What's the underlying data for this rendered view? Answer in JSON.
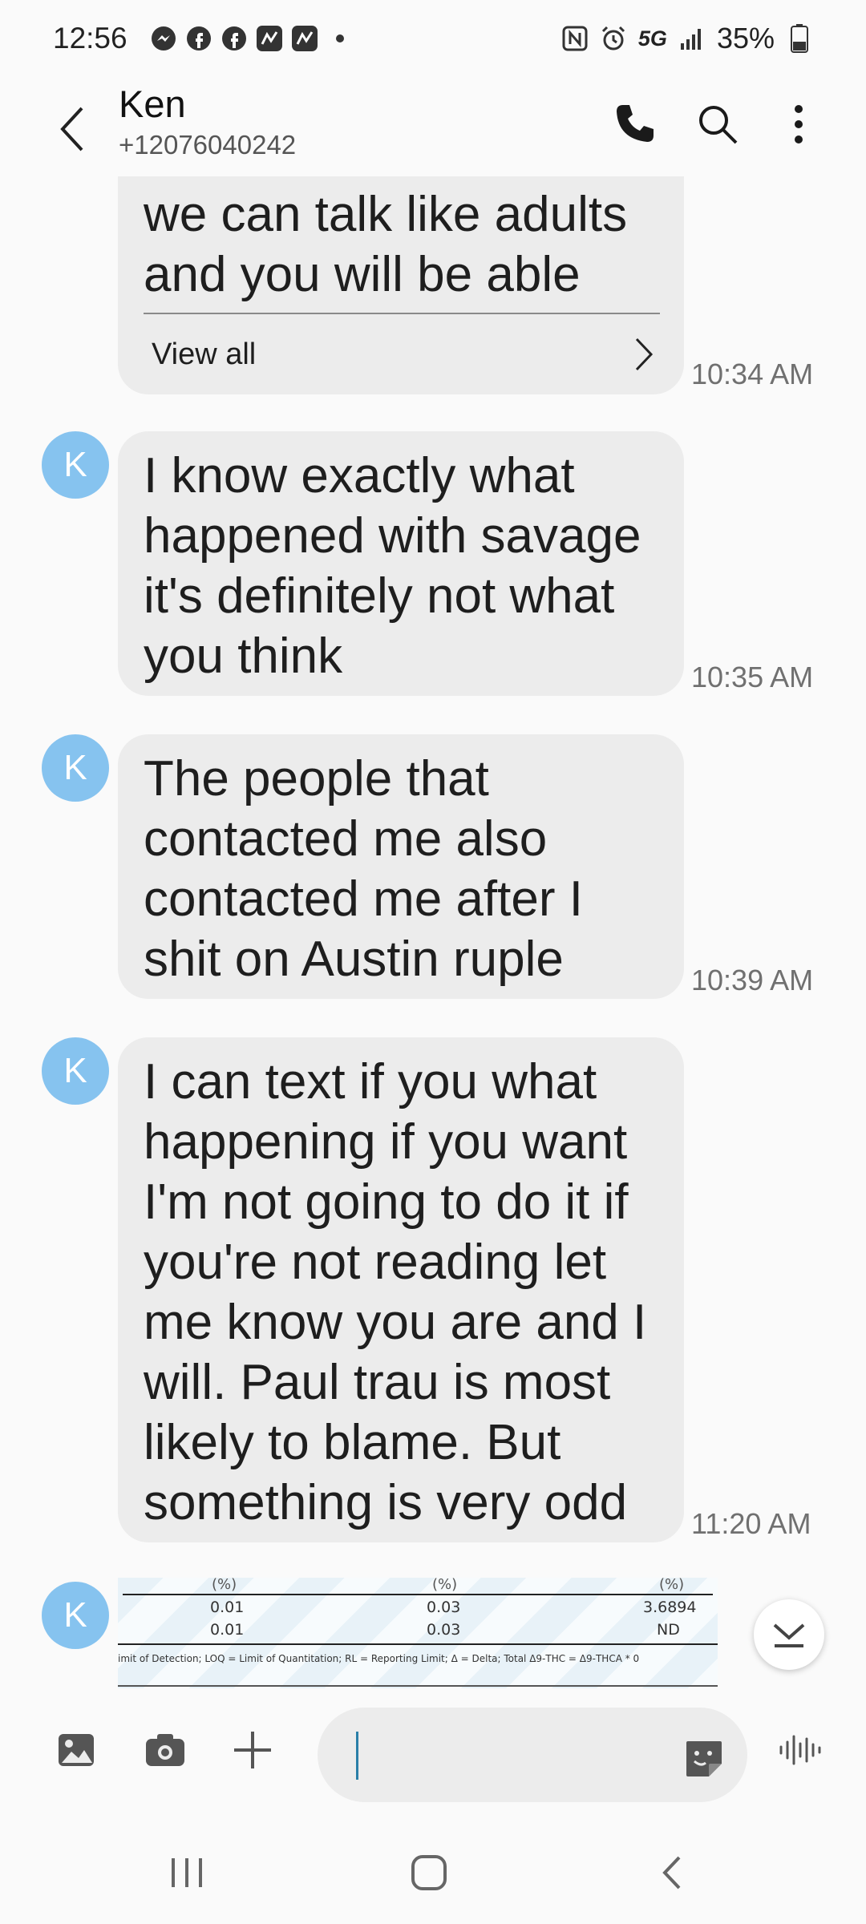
{
  "status_bar": {
    "time": "12:56",
    "network": "5G",
    "battery": "35%"
  },
  "header": {
    "contact_name": "Ken",
    "contact_number": "+12076040242"
  },
  "messages": [
    {
      "text": "we can talk like adults\nand you will be able",
      "timestamp": "10:34 AM",
      "view_all_label": "View all"
    },
    {
      "avatar": "K",
      "text": "I know exactly what\nhappened with savage\nit's definitely not what\nyou think",
      "timestamp": "10:35 AM"
    },
    {
      "avatar": "K",
      "text": "The people that\ncontacted me also\ncontacted me after I\nshit on Austin ruple",
      "timestamp": "10:39 AM"
    },
    {
      "avatar": "K",
      "text": "I can text if you what\nhappening if you want\nI'm not going to do it if\nyou're not reading let\nme know you are and I\nwill.  Paul trau is most\nlikely to blame. But\nsomething is very odd",
      "timestamp": "11:20 AM"
    }
  ],
  "attachment": {
    "avatar": "K",
    "headers": [
      "(%)",
      "(%)",
      "(%)"
    ],
    "rows": [
      [
        "0.01",
        "0.03",
        "3.6894"
      ],
      [
        "0.01",
        "0.03",
        "ND"
      ]
    ],
    "footnote": "imit of Detection; LOQ = Limit of Quantitation; RL = Reporting Limit; Δ = Delta; Total Δ9-THC = Δ9-THCA * 0"
  },
  "input": {
    "placeholder": ""
  },
  "colors": {
    "avatar": "#86c3ef",
    "bubble": "#ececec",
    "caret": "#2a7fa8"
  }
}
